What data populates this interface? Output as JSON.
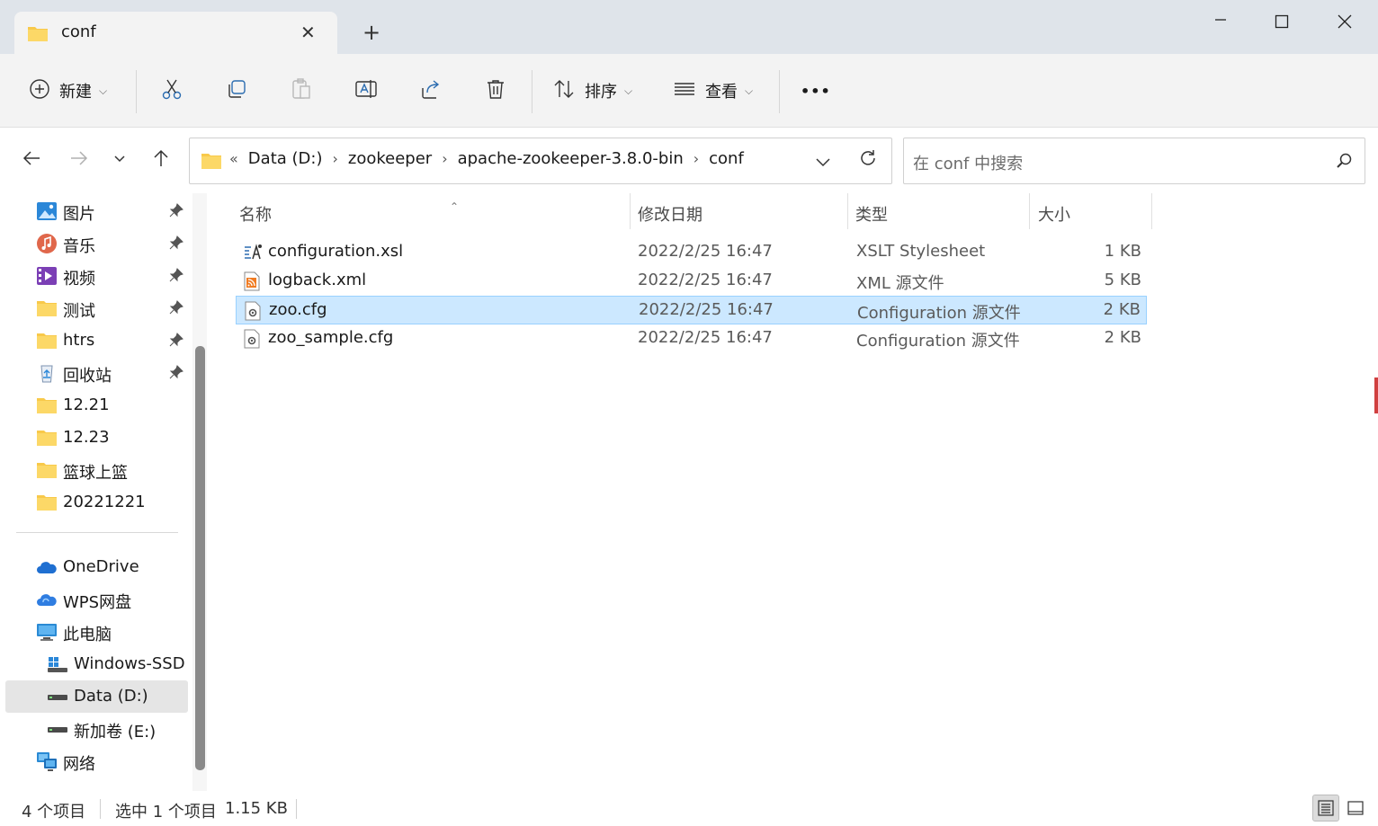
{
  "window": {
    "tab_title": "conf",
    "new_tab": "+",
    "minimize": "—",
    "maximize": "☐",
    "close": "✕"
  },
  "toolbar": {
    "new_label": "新建",
    "sort_label": "排序",
    "view_label": "查看",
    "more_label": "•••"
  },
  "address": {
    "overflow": "«",
    "segments": [
      "Data (D:)",
      "zookeeper",
      "apache-zookeeper-3.8.0-bin",
      "conf"
    ]
  },
  "search": {
    "placeholder": "在 conf 中搜索"
  },
  "sidebar": {
    "quick_access": [
      {
        "label": "图片",
        "icon": "pictures-icon",
        "pinned": true
      },
      {
        "label": "音乐",
        "icon": "music-icon",
        "pinned": true
      },
      {
        "label": "视频",
        "icon": "videos-icon",
        "pinned": true
      },
      {
        "label": "测试",
        "icon": "folder-icon",
        "pinned": true
      },
      {
        "label": "htrs",
        "icon": "folder-icon",
        "pinned": true
      },
      {
        "label": "回收站",
        "icon": "recycle-bin-icon",
        "pinned": true
      },
      {
        "label": "12.21",
        "icon": "folder-icon",
        "pinned": false
      },
      {
        "label": "12.23",
        "icon": "folder-icon",
        "pinned": false
      },
      {
        "label": "篮球上篮",
        "icon": "folder-icon",
        "pinned": false
      },
      {
        "label": "20221221",
        "icon": "folder-icon",
        "pinned": false
      }
    ],
    "locations": [
      {
        "label": "OneDrive",
        "icon": "cloud-icon"
      },
      {
        "label": "WPS网盘",
        "icon": "cloud-icon"
      },
      {
        "label": "此电脑",
        "icon": "computer-icon"
      },
      {
        "label": "Windows-SSD",
        "icon": "windows-drive-icon"
      },
      {
        "label": "Data (D:)",
        "icon": "drive-icon"
      },
      {
        "label": "新加卷 (E:)",
        "icon": "drive-icon"
      },
      {
        "label": "网络",
        "icon": "network-icon"
      }
    ]
  },
  "columns": {
    "name": "名称",
    "date": "修改日期",
    "type": "类型",
    "size": "大小"
  },
  "files": [
    {
      "name": "configuration.xsl",
      "date": "2022/2/25 16:47",
      "type": "XSLT Stylesheet",
      "size": "1 KB",
      "icon": "xsl-file-icon"
    },
    {
      "name": "logback.xml",
      "date": "2022/2/25 16:47",
      "type": "XML 源文件",
      "size": "5 KB",
      "icon": "xml-file-icon"
    },
    {
      "name": "zoo.cfg",
      "date": "2022/2/25 16:47",
      "type": "Configuration 源文件",
      "size": "2 KB",
      "icon": "cfg-file-icon"
    },
    {
      "name": "zoo_sample.cfg",
      "date": "2022/2/25 16:47",
      "type": "Configuration 源文件",
      "size": "2 KB",
      "icon": "cfg-file-icon"
    }
  ],
  "status": {
    "item_count": "4 个项目",
    "selection": "选中 1 个项目",
    "selection_size": "1.15 KB"
  },
  "colors": {
    "accent": "#0067c0",
    "selection_bg": "#cce8ff",
    "selection_border": "#99d1ff",
    "folder": "#f8c94a"
  }
}
